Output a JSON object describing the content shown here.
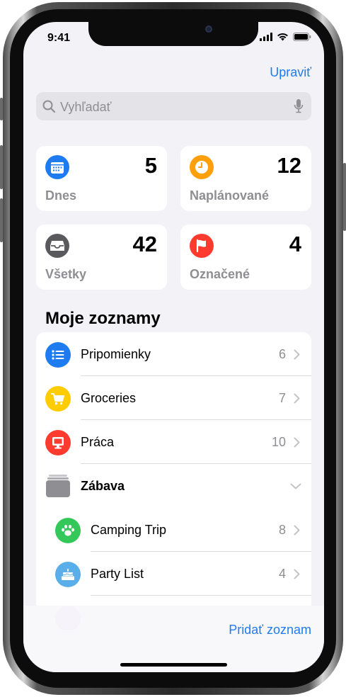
{
  "status_bar": {
    "time": "9:41"
  },
  "header": {
    "edit_label": "Upraviť"
  },
  "search": {
    "placeholder": "Vyhľadať"
  },
  "smart_lists": [
    {
      "label": "Dnes",
      "count": "5",
      "icon": "calendar-icon",
      "color": "#1f7cf0"
    },
    {
      "label": "Naplánované",
      "count": "12",
      "icon": "clock-icon",
      "color": "#ff9f0a"
    },
    {
      "label": "Všetky",
      "count": "42",
      "icon": "tray-icon",
      "color": "#5a5a5e"
    },
    {
      "label": "Označené",
      "count": "4",
      "icon": "flag-icon",
      "color": "#ff3b30"
    }
  ],
  "my_lists": {
    "title": "Moje zoznamy",
    "items": [
      {
        "label": "Pripomienky",
        "count": "6",
        "icon": "list-bullet-icon",
        "color": "#1f7cf0"
      },
      {
        "label": "Groceries",
        "count": "7",
        "icon": "cart-icon",
        "color": "#ffcc00"
      },
      {
        "label": "Práca",
        "count": "10",
        "icon": "monitor-icon",
        "color": "#ff3b30"
      }
    ],
    "group": {
      "label": "Zábava",
      "icon": "folder-stack-icon",
      "items": [
        {
          "label": "Camping Trip",
          "count": "8",
          "icon": "paw-icon",
          "color": "#34c759"
        },
        {
          "label": "Party List",
          "count": "4",
          "icon": "cake-icon",
          "color": "#5aaeea"
        }
      ],
      "partial_item_color": "#bf5af2"
    }
  },
  "footer": {
    "add_list_label": "Pridať zoznam"
  }
}
